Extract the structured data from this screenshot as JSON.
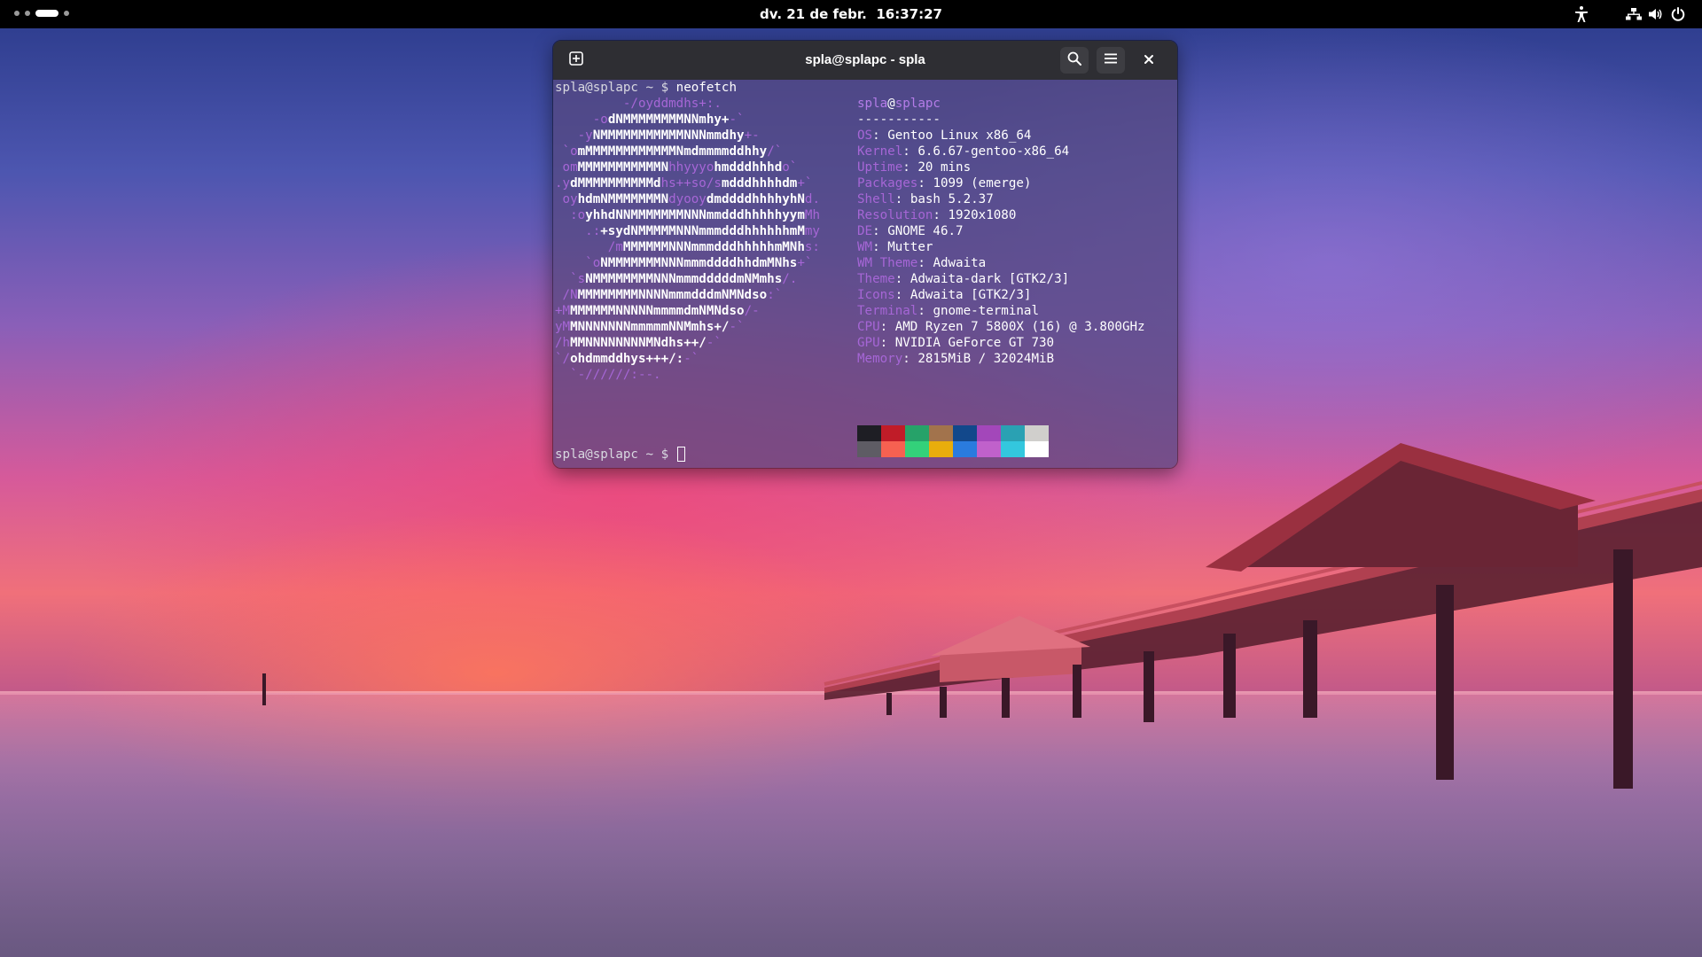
{
  "topbar": {
    "date": "dv. 21 de febr.",
    "time": "16:37:27",
    "workspaces": 4,
    "active_workspace": 3,
    "tray_icons": [
      "accessibility-icon",
      "network-icon",
      "volume-icon",
      "power-icon"
    ]
  },
  "terminal": {
    "title": "spla@splapc - spla",
    "new_tab_icon": "new-tab-icon",
    "search_icon": "search-icon",
    "menu_icon": "hamburger-menu-icon",
    "close_icon": "close-icon",
    "command_prompt": "spla@splapc ~ $ ",
    "command": "neofetch",
    "final_prompt": "spla@splapc ~ $ ",
    "logo_lines": [
      [
        "         ",
        "-/oyddmdhs+:.",
        ""
      ],
      [
        "     ",
        "-o",
        "dNMMMMMMMMNNmhy+",
        "-`"
      ],
      [
        "   ",
        "-y",
        "NMMMMMMMMMMMNNNmmdhy",
        "+-"
      ],
      [
        " ",
        "`o",
        "mMMMMMMMMMMMMNmdmmmmddhhy",
        "/`"
      ],
      [
        " ",
        "om",
        "MMMMMMMMMMMN",
        "hhyyyo",
        "hmdddhhhd",
        "o`"
      ],
      [
        "",
        ".y",
        "dMMMMMMMMMMd",
        "hs++so/s",
        "mdddhhhhdm",
        "+`"
      ],
      [
        " ",
        "oy",
        "hdmNMMMMMMMN",
        "dyooy",
        "dmddddhhhhyhN",
        "d."
      ],
      [
        "  ",
        ":o",
        "yhhdNNMMMMMMMNNNmmdddhhhhhyym",
        "Mh"
      ],
      [
        "    ",
        ".:",
        "+sydNMMMMMNNNmmmdddhhhhhhmM",
        "my"
      ],
      [
        "       ",
        "/m",
        "MMMMMMNNNmmmdddhhhhhmMNh",
        "s:"
      ],
      [
        "    ",
        "`o",
        "NMMMMMMMNNNmmmddddhhdmMNhs",
        "+`"
      ],
      [
        "  ",
        "`s",
        "NMMMMMMMMNNNmmmdddddmNMmhs",
        "/."
      ],
      [
        " ",
        "/N",
        "MMMMMMMMNNNNmmmdddmNMNdso",
        ":`"
      ],
      [
        "",
        "+M",
        "MMMMMMNNNNNmmmmdmNMNdso",
        "/-"
      ],
      [
        "",
        "yM",
        "MNNNNNNNmmmmmNNMmhs+/",
        "-`"
      ],
      [
        "",
        "/h",
        "MMNNNNNNNNMNdhs++/",
        "-`"
      ],
      [
        "",
        "`/",
        "ohdmmddhys+++/:",
        "-`"
      ],
      [
        "  ",
        "`-//////:--."
      ]
    ],
    "info": {
      "user": "spla",
      "at": "@",
      "host": "splapc",
      "separator": "-----------",
      "rows": [
        {
          "key": "OS",
          "value": "Gentoo Linux x86_64"
        },
        {
          "key": "Kernel",
          "value": "6.6.67-gentoo-x86_64"
        },
        {
          "key": "Uptime",
          "value": "20 mins"
        },
        {
          "key": "Packages",
          "value": "1099 (emerge)"
        },
        {
          "key": "Shell",
          "value": "bash 5.2.37"
        },
        {
          "key": "Resolution",
          "value": "1920x1080"
        },
        {
          "key": "DE",
          "value": "GNOME 46.7"
        },
        {
          "key": "WM",
          "value": "Mutter"
        },
        {
          "key": "WM Theme",
          "value": "Adwaita"
        },
        {
          "key": "Theme",
          "value": "Adwaita-dark [GTK2/3]"
        },
        {
          "key": "Icons",
          "value": "Adwaita [GTK2/3]"
        },
        {
          "key": "Terminal",
          "value": "gnome-terminal"
        },
        {
          "key": "CPU",
          "value": "AMD Ryzen 7 5800X (16) @ 3.800GHz"
        },
        {
          "key": "GPU",
          "value": "NVIDIA GeForce GT 730"
        },
        {
          "key": "Memory",
          "value": "2815MiB / 32024MiB"
        }
      ]
    },
    "palette_top": [
      "#1e1e24",
      "#c01c28",
      "#26a269",
      "#a2734c",
      "#12488b",
      "#a347ba",
      "#2aa1b3",
      "#d0cfcc"
    ],
    "palette_bottom": [
      "#5e5c64",
      "#f66151",
      "#33d17a",
      "#e9ad0c",
      "#2a7bde",
      "#c061cb",
      "#33c7de",
      "#ffffff"
    ]
  }
}
